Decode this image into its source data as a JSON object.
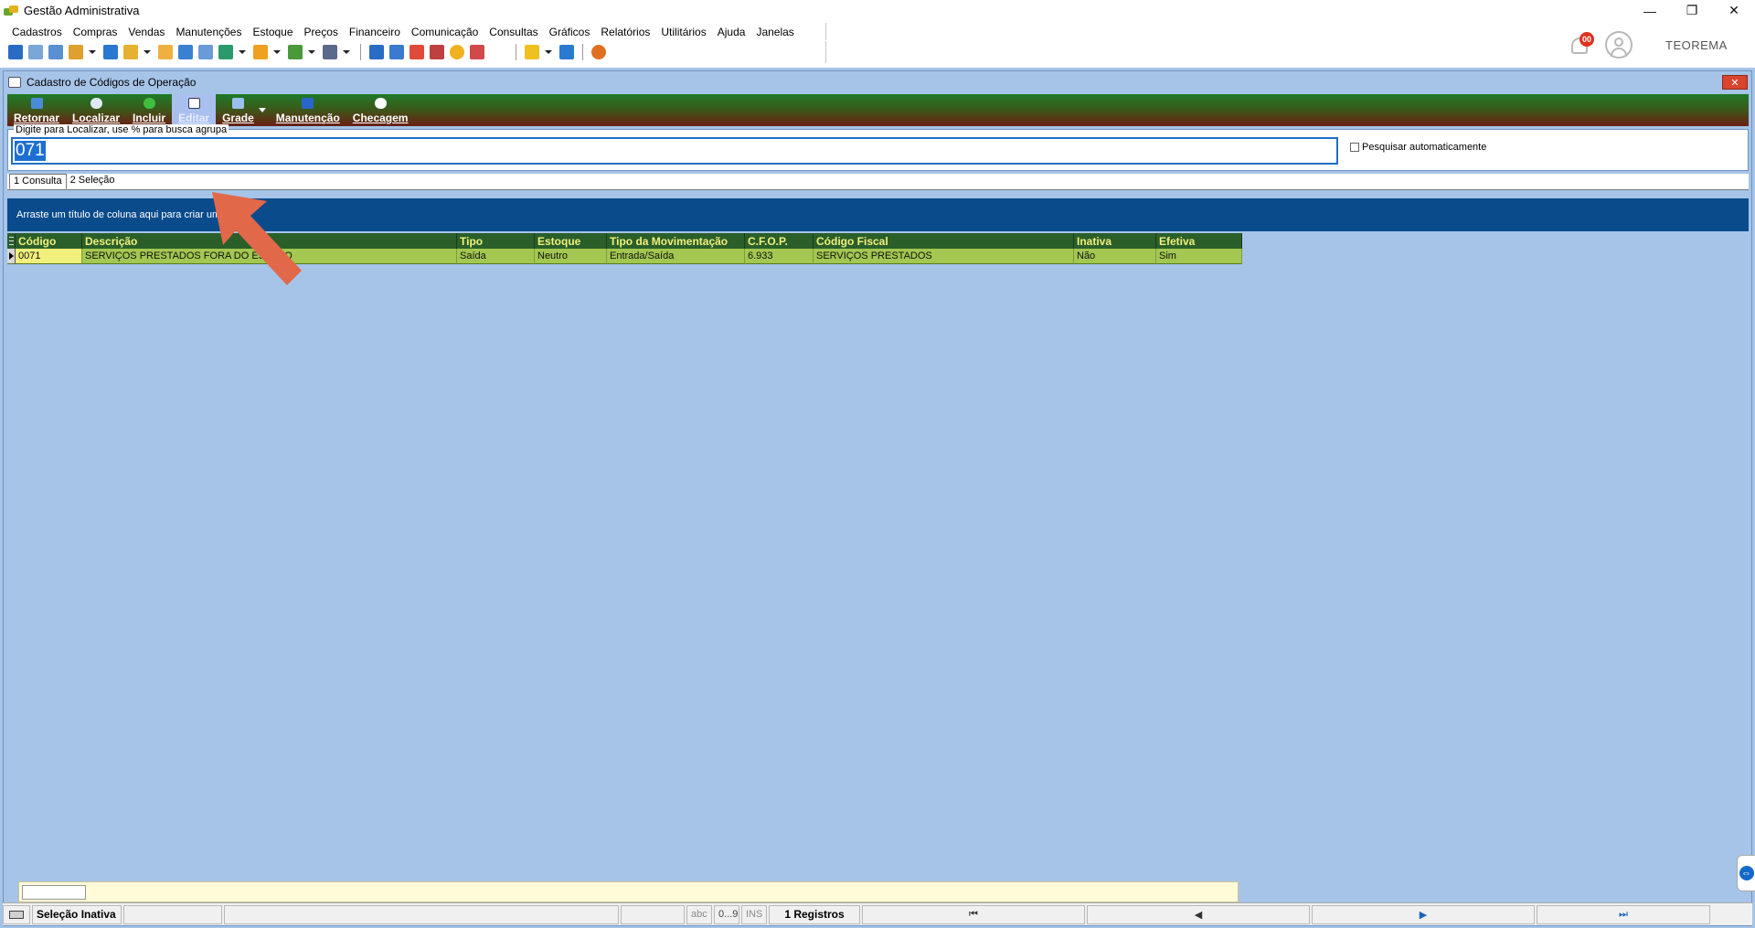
{
  "window": {
    "title": "Gestão Administrativa",
    "min_glyph": "—",
    "restore_glyph": "❐",
    "close_glyph": "✕"
  },
  "menubar": {
    "items": [
      {
        "label": "Cadastros"
      },
      {
        "label": "Compras"
      },
      {
        "label": "Vendas"
      },
      {
        "label": "Manutenções"
      },
      {
        "label": "Estoque"
      },
      {
        "label": "Preços"
      },
      {
        "label": "Financeiro"
      },
      {
        "label": "Comunicação"
      },
      {
        "label": "Consultas"
      },
      {
        "label": "Gráficos"
      },
      {
        "label": "Relatórios"
      },
      {
        "label": "Utilitários"
      },
      {
        "label": "Ajuda"
      },
      {
        "label": "Janelas"
      }
    ]
  },
  "notifications": {
    "badge": "00"
  },
  "brand": "TEOREMA",
  "child_window": {
    "title": "Cadastro de Códigos de Operação",
    "close_glyph": "✕"
  },
  "ribbon": {
    "buttons": [
      {
        "label": "Retornar",
        "icon": "return-icon",
        "color": "#4a8cd8"
      },
      {
        "label": "Localizar",
        "icon": "magnifier-icon",
        "color": "#dfe8f6"
      },
      {
        "label": "Incluir",
        "icon": "plus-circle-icon",
        "color": "#3fbf3f"
      },
      {
        "label": "Editar",
        "icon": "edit-icon",
        "color": "#ffffff"
      },
      {
        "label": "Grade",
        "icon": "grid-icon",
        "color": "#9ac0f0"
      },
      {
        "label": "Manutenção",
        "icon": "tools-icon",
        "color": "#2a66c9"
      },
      {
        "label": "Checagem",
        "icon": "gear-icon",
        "color": "#ffffff"
      }
    ]
  },
  "search": {
    "caption": "Digite para Localizar, use % para busca agrupa",
    "value": "071",
    "auto_label": "Pesquisar automaticamente"
  },
  "tabs": [
    {
      "label": "1 Consulta"
    },
    {
      "label": "2 Seleção"
    }
  ],
  "group_band": "Arraste um título de coluna aqui para criar um grupo",
  "grid": {
    "columns": [
      "Código",
      "Descrição",
      "Tipo",
      "Estoque",
      "Tipo da Movimentação",
      "C.F.O.P.",
      "Código Fiscal",
      "Inativa",
      "Efetiva"
    ],
    "rows": [
      [
        "0071",
        "SERVIÇOS PRESTADOS  FORA DO ESTADO",
        "Saída",
        "Neutro",
        "Entrada/Saída",
        "6.933",
        "SERVIÇOS PRESTADOS",
        "Não",
        "Sim"
      ]
    ]
  },
  "statusbar": {
    "selection": "Seleção Inativa",
    "abc": "abc",
    "digits": "0...9",
    "ins": "INS",
    "records": "1 Registros",
    "nav_first": "⏮",
    "nav_prev": "◀",
    "nav_next": "▶",
    "nav_last": "⏭"
  },
  "colors": {
    "accent_blue": "#0a4b8c",
    "mdi_background": "#a6c4e8",
    "grid_header": "#2a5f2a",
    "grid_row": "#a3c750",
    "arrow": "#e2684a"
  }
}
